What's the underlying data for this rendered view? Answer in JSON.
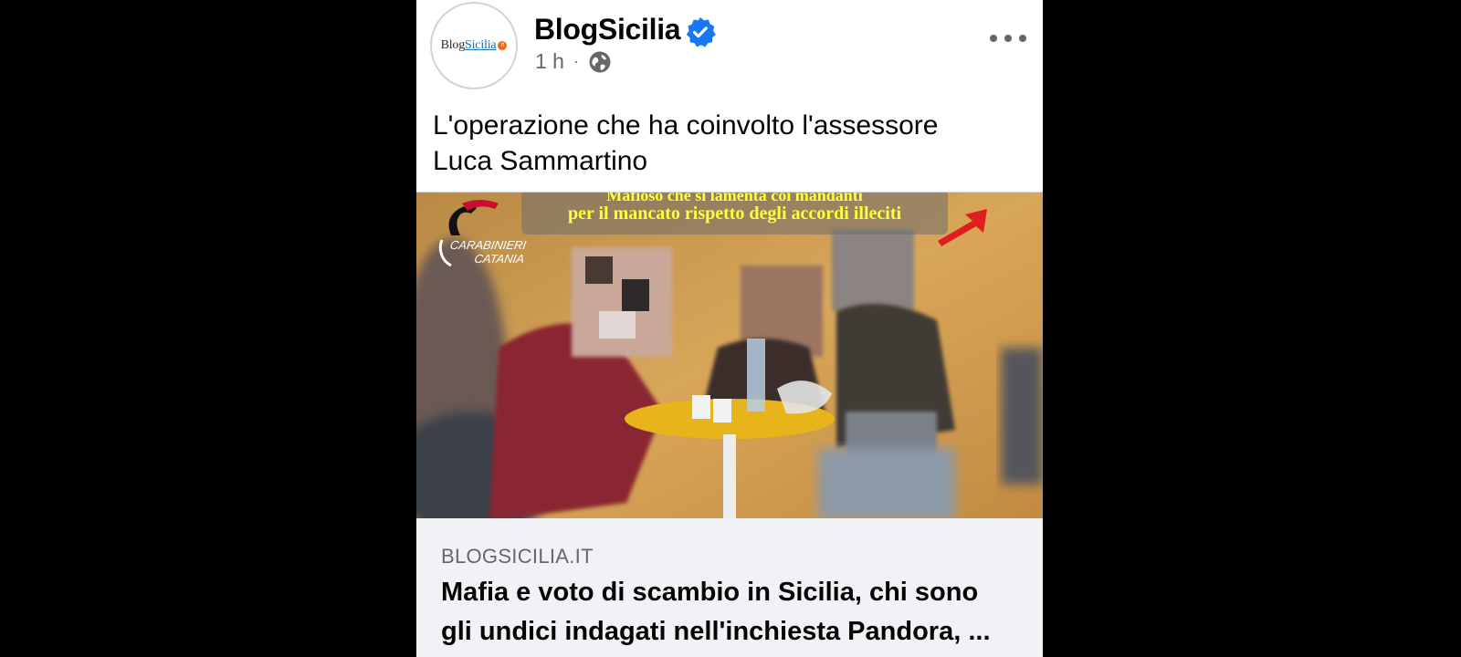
{
  "post": {
    "page_name": "BlogSicilia",
    "avatar_logo": {
      "part1": "Blog",
      "part2": "Sicilia",
      "badge": "it"
    },
    "time": "1 h",
    "separator": "·",
    "privacy_icon": "globe-icon",
    "verified_icon": "verified-badge-icon",
    "more_icon": "more-options-icon",
    "caption_line1": "L'operazione che ha coinvolto l'assessore",
    "caption_line2": "Luca Sammartino"
  },
  "media": {
    "overlay_line1": "Mafioso che si lamenta coi mandanti",
    "overlay_line2": "per il mancato rispetto degli accordi illeciti",
    "watermark_line1": "CARABINIERI",
    "watermark_line2": "CATANIA"
  },
  "link_preview": {
    "domain": "BLOGSICILIA.IT",
    "headline": "Mafia e voto di scambio in Sicilia, chi sono gli undici indagati nell'inchiesta Pandora, ..."
  },
  "colors": {
    "verified": "#1877f2",
    "background": "#000000",
    "card": "#ffffff",
    "link_bg": "#f0f2f5",
    "overlay_text": "#ffff3a"
  }
}
